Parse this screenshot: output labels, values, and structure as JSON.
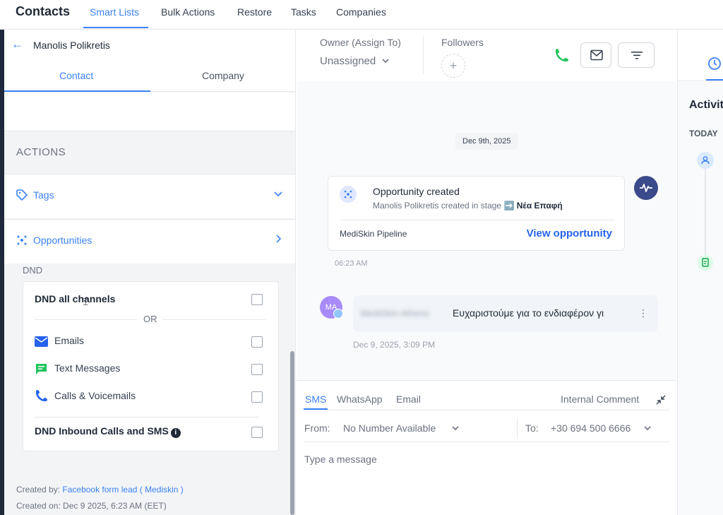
{
  "nav": {
    "title": "Contacts",
    "tabs": [
      "Smart Lists",
      "Bulk Actions",
      "Restore",
      "Tasks",
      "Companies"
    ]
  },
  "left": {
    "back_icon": "arrow-left-icon",
    "contact_name": "Manolis Polikretis",
    "tabs": {
      "contact": "Contact",
      "company": "Company"
    },
    "actions_title": "ACTIONS",
    "tags_label": "Tags",
    "opportunities_label": "Opportunities",
    "dnd": {
      "section_label": "DND",
      "all_channels": "DND all channels",
      "or": "OR",
      "emails": "Emails",
      "text_messages": "Text Messages",
      "calls_voicemails": "Calls & Voicemails",
      "inbound": "DND Inbound Calls and SMS",
      "info": "i"
    },
    "created_by_label": "Created by:",
    "created_by_value": "Facebook form lead ( Mediskin )",
    "created_on": "Created on: Dec 9 2025, 6:23 AM (EET)"
  },
  "center": {
    "owner_label": "Owner (Assign To)",
    "owner_value": "Unassigned",
    "followers_label": "Followers",
    "plus": "+",
    "date_pill": "Dec 9th, 2025",
    "opportunity": {
      "title": "Opportunity created",
      "sub_prefix": "Manolis Polikretis created in stage",
      "stage_icon": "➡️",
      "stage": "Νέα Επαφή",
      "pipeline": "MediSkin Pipeline",
      "view_link": "View opportunity",
      "time": "06:23 AM"
    },
    "message": {
      "avatar_initials": "MA",
      "sender": "MediSkin Athens",
      "text": "Ευχαριστούμε για το ενδιαφέρον γι",
      "more": "⋮",
      "time": "Dec 9, 2025, 3:09 PM"
    },
    "composer": {
      "tabs": [
        "SMS",
        "WhatsApp",
        "Email"
      ],
      "internal_comment": "Internal Comment",
      "from_label": "From:",
      "from_value": "No Number Available",
      "to_label": "To:",
      "to_value": "+30 694 500 6666",
      "placeholder": "Type a message"
    }
  },
  "right": {
    "activity_title": "Activity",
    "today": "TODAY"
  },
  "colors": {
    "accent": "#3b82f6",
    "phone_green": "#22c55e",
    "pulse_navy": "#3b4a8a"
  }
}
